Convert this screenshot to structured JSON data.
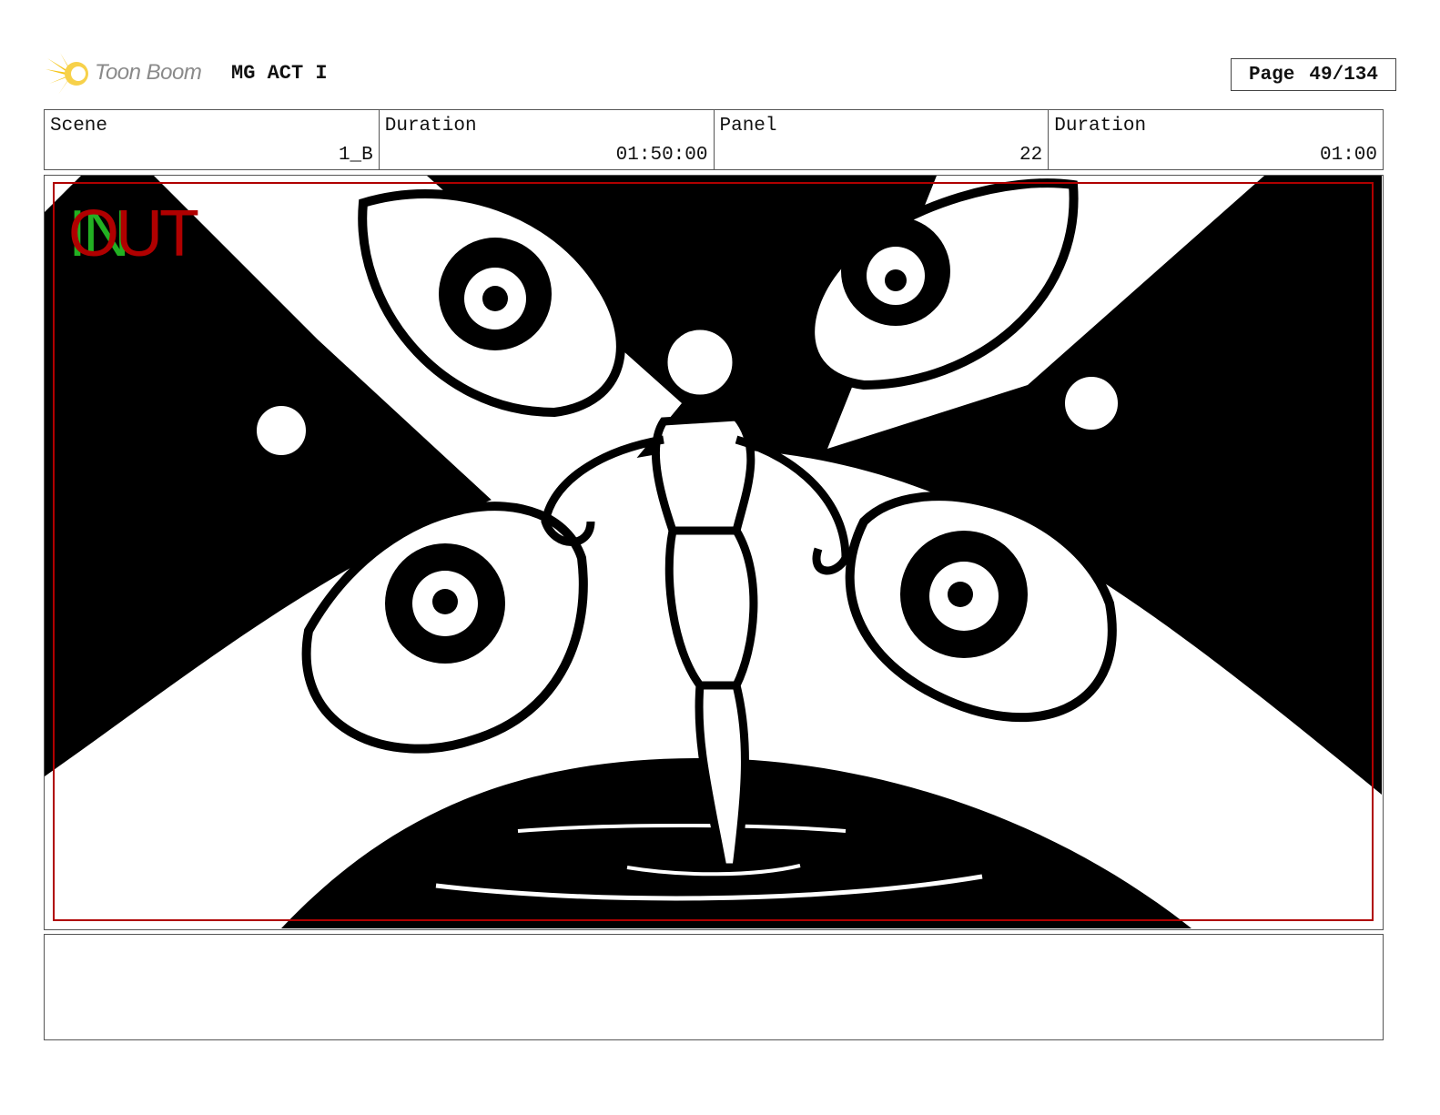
{
  "header": {
    "logo_text": "Toon Boom",
    "project_title": "MG ACT I",
    "page_label": "Page",
    "page_value": "49/134"
  },
  "info": {
    "scene_label": "Scene",
    "scene_value": "1_B",
    "scene_duration_label": "Duration",
    "scene_duration_value": "01:50:00",
    "panel_label": "Panel",
    "panel_value": "22",
    "panel_duration_label": "Duration",
    "panel_duration_value": "01:00"
  },
  "panel": {
    "in_marker": "IN",
    "out_marker": "OUT",
    "in_color": "#22b022",
    "out_color": "#b00000",
    "safe_frame_color": "#b00000"
  },
  "colors": {
    "logo_star": "#f5c518",
    "ink": "#000000",
    "paper": "#ffffff"
  },
  "notes": {
    "text": ""
  }
}
